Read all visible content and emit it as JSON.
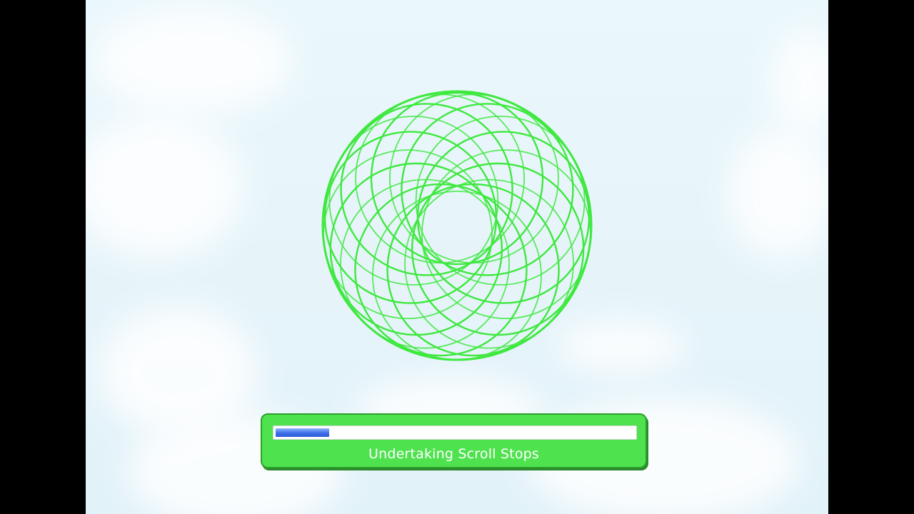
{
  "loading": {
    "status_text": "Undertaking Scroll Stops",
    "progress_percent": 15
  },
  "colors": {
    "sky": "#e6f4fa",
    "spirograph": "#3ee83e",
    "panel": "#4fe24f",
    "panel_border": "#2c9f2c",
    "progress_fill": "#3f6fe8",
    "letterbox": "#000000"
  }
}
